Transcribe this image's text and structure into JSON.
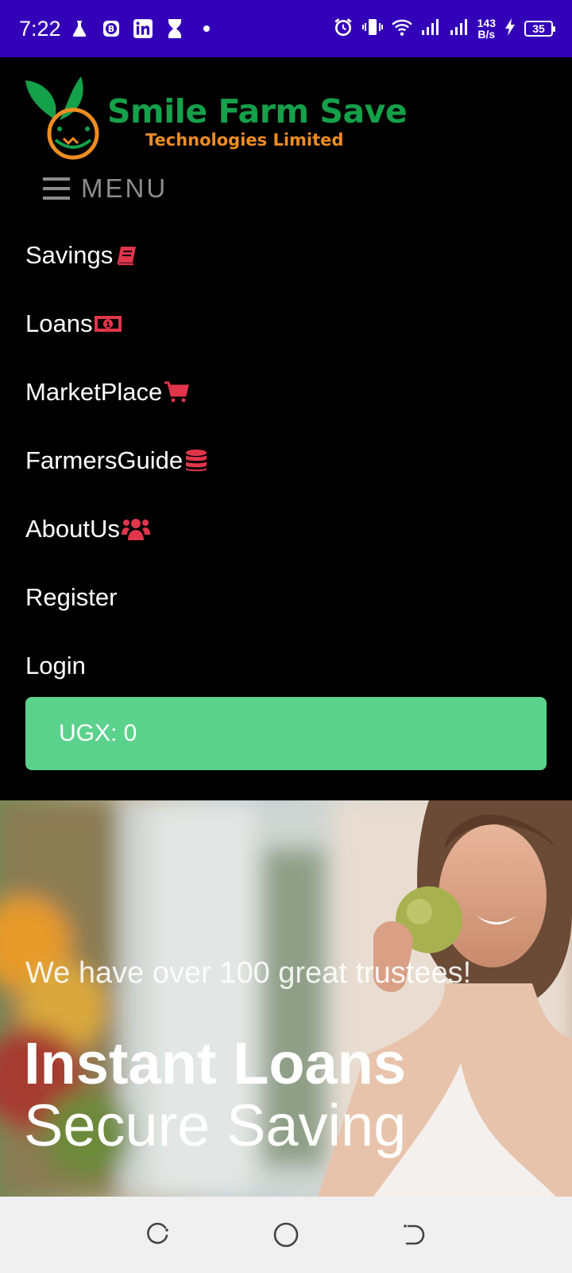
{
  "status_bar": {
    "time": "7:22",
    "net_speed_value": "143",
    "net_speed_unit": "B/s",
    "battery": "35",
    "icons": [
      "flask-icon",
      "bitcoin-icon",
      "linkedin-icon",
      "hourglass-icon",
      "dot-icon",
      "alarm-icon",
      "vibrate-icon",
      "wifi-icon",
      "signal-icon",
      "signal-icon",
      "charging-icon"
    ]
  },
  "brand": {
    "name": "Smile Farm Save",
    "subtitle": "Technologies Limited",
    "primary_color": "#15a04a",
    "secondary_color": "#ee8d22"
  },
  "menu": {
    "toggle_label": "MENU",
    "items": [
      {
        "label": "Savings",
        "icon": "book-icon"
      },
      {
        "label": "Loans",
        "icon": "money-bill-icon"
      },
      {
        "label": "MarketPlace",
        "icon": "cart-icon"
      },
      {
        "label": "FarmersGuide",
        "icon": "database-icon"
      },
      {
        "label": "AboutUs",
        "icon": "users-icon"
      },
      {
        "label": "Register",
        "icon": ""
      },
      {
        "label": "Login",
        "icon": ""
      }
    ],
    "icon_color": "#e0354b"
  },
  "balance": {
    "label": "UGX: 0",
    "color": "#5bd28c"
  },
  "hero": {
    "subtitle": "We have over 100 great trustees!",
    "title_line1": "Instant Loans",
    "title_line2": "Secure Saving"
  },
  "system_nav": {
    "buttons": [
      "recents-icon",
      "home-icon",
      "back-icon"
    ]
  }
}
